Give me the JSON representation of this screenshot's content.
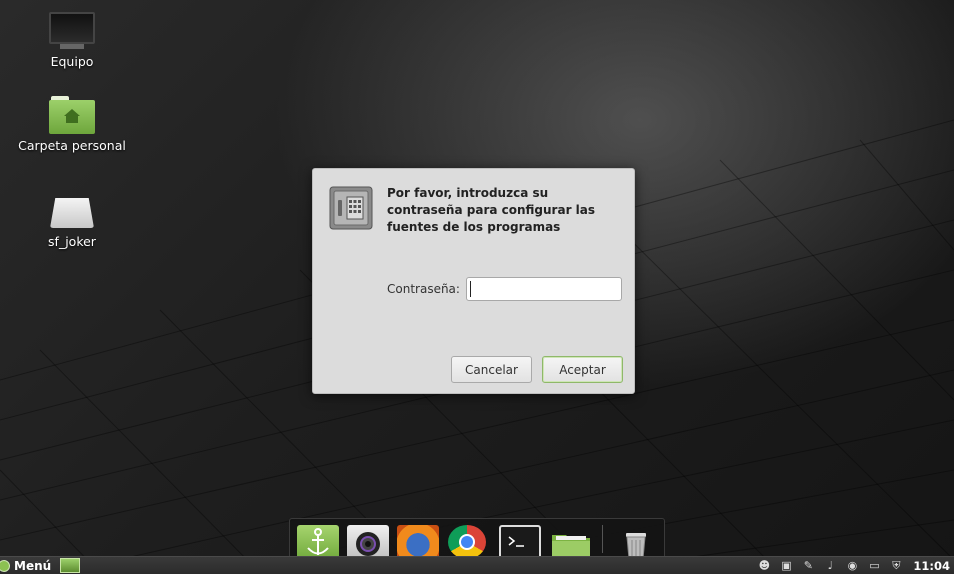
{
  "desktop": {
    "icons": [
      {
        "label": "Equipo"
      },
      {
        "label": "Carpeta personal"
      },
      {
        "label": "sf_joker"
      }
    ]
  },
  "dialog": {
    "message": "Por favor, introduzca su contraseña para configurar las fuentes de los programas",
    "password_label": "Contraseña:",
    "password_value": "",
    "cancel_label": "Cancelar",
    "accept_label": "Aceptar"
  },
  "dock": {
    "items": [
      "anchor-icon",
      "camera-icon",
      "firefox-icon",
      "chrome-icon",
      "terminal-icon",
      "folder-icon",
      "trash-icon"
    ]
  },
  "panel": {
    "menu_label": "Menú",
    "clock": "11:04",
    "accent": "#8cc152"
  }
}
